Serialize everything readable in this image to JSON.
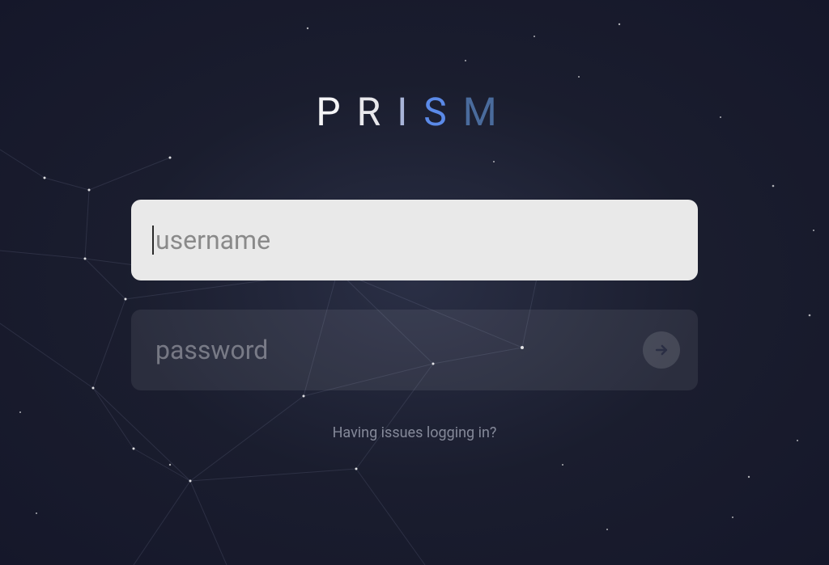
{
  "brand": {
    "name": "PRISM",
    "letters": [
      "P",
      "R",
      "I",
      "S",
      "M"
    ]
  },
  "form": {
    "username": {
      "placeholder": "username",
      "value": ""
    },
    "password": {
      "placeholder": "password",
      "value": ""
    }
  },
  "help": {
    "text": "Having issues logging in?"
  },
  "colors": {
    "background_dark": "#1a1d2e",
    "background_light": "#2a2f45",
    "input_active": "#e9e9e9",
    "input_inactive": "rgba(255,255,255,0.08)",
    "logo_p": "#f5f5f7",
    "logo_r": "#e8e8ec",
    "logo_i": "#a8b4d8",
    "logo_s": "#5b8ae8",
    "logo_m": "#4a6b9c"
  }
}
